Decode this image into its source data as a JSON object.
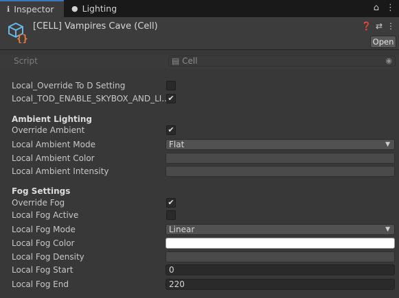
{
  "tabs": [
    {
      "label": "Inspector",
      "icon": "info-icon"
    },
    {
      "label": "Lighting",
      "icon": "bulb-icon"
    }
  ],
  "header": {
    "title": "[CELL] Vampires Cave (Cell)",
    "open_label": "Open"
  },
  "script": {
    "label": "Script",
    "value": "Cell"
  },
  "fields": {
    "override_tod": {
      "label": "Local_Override To D Setting",
      "checked": false
    },
    "tod_enable_skybox": {
      "label": "Local_TOD_ENABLE_SKYBOX_AND_LI...",
      "checked": true
    }
  },
  "ambient": {
    "section_title": "Ambient Lighting",
    "override": {
      "label": "Override Ambient",
      "checked": true
    },
    "mode": {
      "label": "Local Ambient Mode",
      "value": "Flat"
    },
    "color": {
      "label": "Local Ambient Color",
      "value": "#4a4a4a"
    },
    "intensity": {
      "label": "Local Ambient Intensity"
    }
  },
  "fog": {
    "section_title": "Fog Settings",
    "override": {
      "label": "Override Fog",
      "checked": true
    },
    "active": {
      "label": "Local Fog Active",
      "checked": false
    },
    "mode": {
      "label": "Local Fog Mode",
      "value": "Linear"
    },
    "color": {
      "label": "Local Fog Color",
      "value": "#ffffff"
    },
    "density": {
      "label": "Local Fog Density"
    },
    "start": {
      "label": "Local Fog Start",
      "value": "0"
    },
    "end": {
      "label": "Local Fog End",
      "value": "220"
    }
  },
  "check_glyph": "✔",
  "colors": {
    "accent": "#3a79bb",
    "panel": "#383838",
    "field": "#2a2a2a"
  }
}
